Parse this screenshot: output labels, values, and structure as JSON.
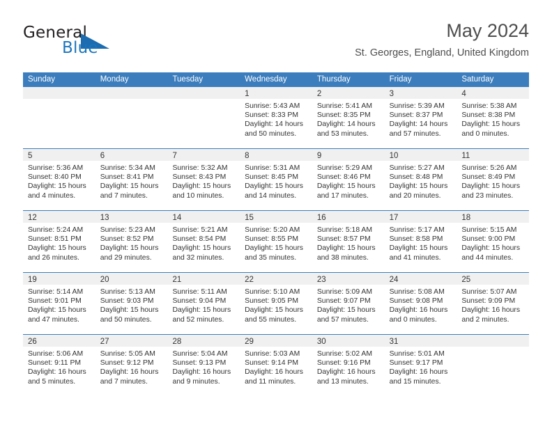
{
  "brand": {
    "name_part1": "General",
    "name_part2": "Blue",
    "triangle_color": "#1b6cb0",
    "blue_color": "#1b75bb"
  },
  "header": {
    "title": "May 2024",
    "location": "St. Georges, England, United Kingdom"
  },
  "theme": {
    "header_blue": "#3b7dbd",
    "day_band_gray": "#f0f0f0",
    "text_color": "#333333"
  },
  "calendar": {
    "weekdays": [
      "Sunday",
      "Monday",
      "Tuesday",
      "Wednesday",
      "Thursday",
      "Friday",
      "Saturday"
    ],
    "labels": {
      "sunrise": "Sunrise:",
      "sunset": "Sunset:",
      "daylight": "Daylight:"
    },
    "weeks": [
      [
        {
          "day": "",
          "empty": true
        },
        {
          "day": "",
          "empty": true
        },
        {
          "day": "",
          "empty": true
        },
        {
          "day": "1",
          "sunrise": "Sunrise: 5:43 AM",
          "sunset": "Sunset: 8:33 PM",
          "daylight1": "Daylight: 14 hours",
          "daylight2": "and 50 minutes."
        },
        {
          "day": "2",
          "sunrise": "Sunrise: 5:41 AM",
          "sunset": "Sunset: 8:35 PM",
          "daylight1": "Daylight: 14 hours",
          "daylight2": "and 53 minutes."
        },
        {
          "day": "3",
          "sunrise": "Sunrise: 5:39 AM",
          "sunset": "Sunset: 8:37 PM",
          "daylight1": "Daylight: 14 hours",
          "daylight2": "and 57 minutes."
        },
        {
          "day": "4",
          "sunrise": "Sunrise: 5:38 AM",
          "sunset": "Sunset: 8:38 PM",
          "daylight1": "Daylight: 15 hours",
          "daylight2": "and 0 minutes."
        }
      ],
      [
        {
          "day": "5",
          "sunrise": "Sunrise: 5:36 AM",
          "sunset": "Sunset: 8:40 PM",
          "daylight1": "Daylight: 15 hours",
          "daylight2": "and 4 minutes."
        },
        {
          "day": "6",
          "sunrise": "Sunrise: 5:34 AM",
          "sunset": "Sunset: 8:41 PM",
          "daylight1": "Daylight: 15 hours",
          "daylight2": "and 7 minutes."
        },
        {
          "day": "7",
          "sunrise": "Sunrise: 5:32 AM",
          "sunset": "Sunset: 8:43 PM",
          "daylight1": "Daylight: 15 hours",
          "daylight2": "and 10 minutes."
        },
        {
          "day": "8",
          "sunrise": "Sunrise: 5:31 AM",
          "sunset": "Sunset: 8:45 PM",
          "daylight1": "Daylight: 15 hours",
          "daylight2": "and 14 minutes."
        },
        {
          "day": "9",
          "sunrise": "Sunrise: 5:29 AM",
          "sunset": "Sunset: 8:46 PM",
          "daylight1": "Daylight: 15 hours",
          "daylight2": "and 17 minutes."
        },
        {
          "day": "10",
          "sunrise": "Sunrise: 5:27 AM",
          "sunset": "Sunset: 8:48 PM",
          "daylight1": "Daylight: 15 hours",
          "daylight2": "and 20 minutes."
        },
        {
          "day": "11",
          "sunrise": "Sunrise: 5:26 AM",
          "sunset": "Sunset: 8:49 PM",
          "daylight1": "Daylight: 15 hours",
          "daylight2": "and 23 minutes."
        }
      ],
      [
        {
          "day": "12",
          "sunrise": "Sunrise: 5:24 AM",
          "sunset": "Sunset: 8:51 PM",
          "daylight1": "Daylight: 15 hours",
          "daylight2": "and 26 minutes."
        },
        {
          "day": "13",
          "sunrise": "Sunrise: 5:23 AM",
          "sunset": "Sunset: 8:52 PM",
          "daylight1": "Daylight: 15 hours",
          "daylight2": "and 29 minutes."
        },
        {
          "day": "14",
          "sunrise": "Sunrise: 5:21 AM",
          "sunset": "Sunset: 8:54 PM",
          "daylight1": "Daylight: 15 hours",
          "daylight2": "and 32 minutes."
        },
        {
          "day": "15",
          "sunrise": "Sunrise: 5:20 AM",
          "sunset": "Sunset: 8:55 PM",
          "daylight1": "Daylight: 15 hours",
          "daylight2": "and 35 minutes."
        },
        {
          "day": "16",
          "sunrise": "Sunrise: 5:18 AM",
          "sunset": "Sunset: 8:57 PM",
          "daylight1": "Daylight: 15 hours",
          "daylight2": "and 38 minutes."
        },
        {
          "day": "17",
          "sunrise": "Sunrise: 5:17 AM",
          "sunset": "Sunset: 8:58 PM",
          "daylight1": "Daylight: 15 hours",
          "daylight2": "and 41 minutes."
        },
        {
          "day": "18",
          "sunrise": "Sunrise: 5:15 AM",
          "sunset": "Sunset: 9:00 PM",
          "daylight1": "Daylight: 15 hours",
          "daylight2": "and 44 minutes."
        }
      ],
      [
        {
          "day": "19",
          "sunrise": "Sunrise: 5:14 AM",
          "sunset": "Sunset: 9:01 PM",
          "daylight1": "Daylight: 15 hours",
          "daylight2": "and 47 minutes."
        },
        {
          "day": "20",
          "sunrise": "Sunrise: 5:13 AM",
          "sunset": "Sunset: 9:03 PM",
          "daylight1": "Daylight: 15 hours",
          "daylight2": "and 50 minutes."
        },
        {
          "day": "21",
          "sunrise": "Sunrise: 5:11 AM",
          "sunset": "Sunset: 9:04 PM",
          "daylight1": "Daylight: 15 hours",
          "daylight2": "and 52 minutes."
        },
        {
          "day": "22",
          "sunrise": "Sunrise: 5:10 AM",
          "sunset": "Sunset: 9:05 PM",
          "daylight1": "Daylight: 15 hours",
          "daylight2": "and 55 minutes."
        },
        {
          "day": "23",
          "sunrise": "Sunrise: 5:09 AM",
          "sunset": "Sunset: 9:07 PM",
          "daylight1": "Daylight: 15 hours",
          "daylight2": "and 57 minutes."
        },
        {
          "day": "24",
          "sunrise": "Sunrise: 5:08 AM",
          "sunset": "Sunset: 9:08 PM",
          "daylight1": "Daylight: 16 hours",
          "daylight2": "and 0 minutes."
        },
        {
          "day": "25",
          "sunrise": "Sunrise: 5:07 AM",
          "sunset": "Sunset: 9:09 PM",
          "daylight1": "Daylight: 16 hours",
          "daylight2": "and 2 minutes."
        }
      ],
      [
        {
          "day": "26",
          "sunrise": "Sunrise: 5:06 AM",
          "sunset": "Sunset: 9:11 PM",
          "daylight1": "Daylight: 16 hours",
          "daylight2": "and 5 minutes."
        },
        {
          "day": "27",
          "sunrise": "Sunrise: 5:05 AM",
          "sunset": "Sunset: 9:12 PM",
          "daylight1": "Daylight: 16 hours",
          "daylight2": "and 7 minutes."
        },
        {
          "day": "28",
          "sunrise": "Sunrise: 5:04 AM",
          "sunset": "Sunset: 9:13 PM",
          "daylight1": "Daylight: 16 hours",
          "daylight2": "and 9 minutes."
        },
        {
          "day": "29",
          "sunrise": "Sunrise: 5:03 AM",
          "sunset": "Sunset: 9:14 PM",
          "daylight1": "Daylight: 16 hours",
          "daylight2": "and 11 minutes."
        },
        {
          "day": "30",
          "sunrise": "Sunrise: 5:02 AM",
          "sunset": "Sunset: 9:16 PM",
          "daylight1": "Daylight: 16 hours",
          "daylight2": "and 13 minutes."
        },
        {
          "day": "31",
          "sunrise": "Sunrise: 5:01 AM",
          "sunset": "Sunset: 9:17 PM",
          "daylight1": "Daylight: 16 hours",
          "daylight2": "and 15 minutes."
        },
        {
          "day": "",
          "empty": true
        }
      ]
    ]
  }
}
